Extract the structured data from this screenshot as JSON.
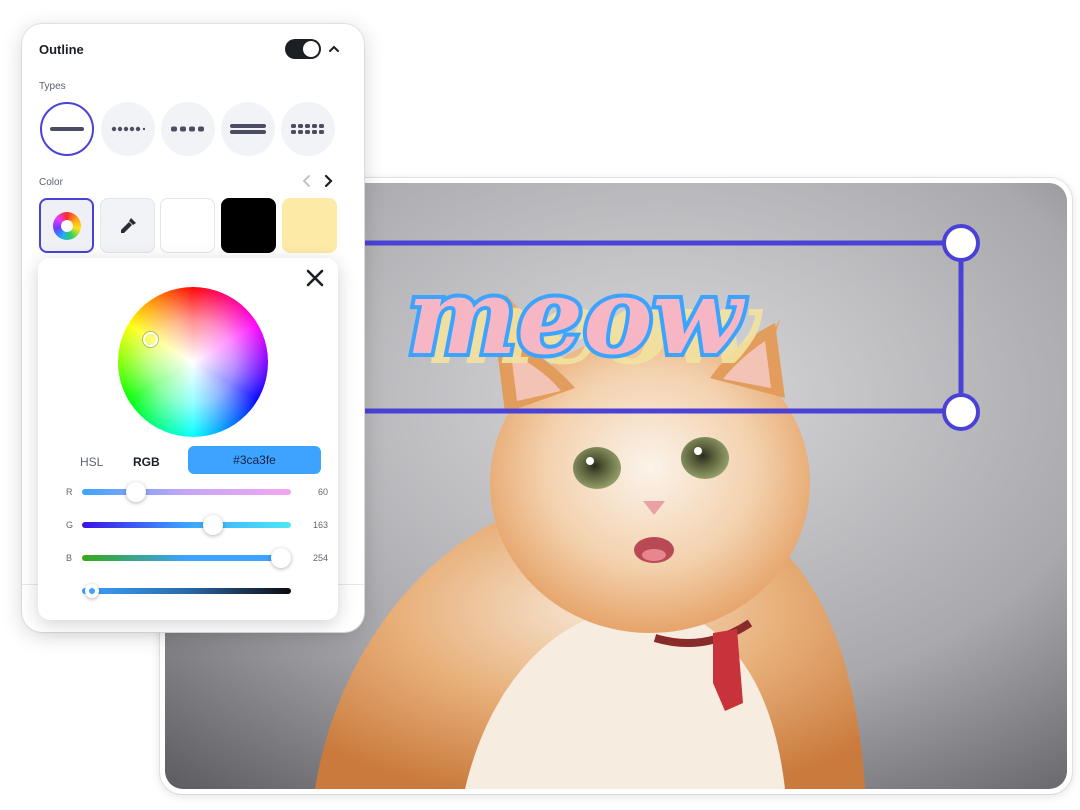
{
  "outline_panel": {
    "title": "Outline",
    "enabled": true,
    "types_label": "Types",
    "types": [
      "solid-line-icon",
      "dotted-line-icon",
      "dashed-line-icon",
      "double-line-icon",
      "double-dotted-line-icon"
    ],
    "selected_type": 0,
    "color_label": "Color",
    "swatches": [
      {
        "kind": "color-wheel-icon"
      },
      {
        "kind": "eyedropper-icon"
      },
      {
        "kind": "color",
        "color": "#ffffff"
      },
      {
        "kind": "color",
        "color": "#000000"
      },
      {
        "kind": "color",
        "color": "#fdeaa7"
      }
    ],
    "selected_swatch": 0
  },
  "color_picker": {
    "modes": [
      "HSL",
      "RGB"
    ],
    "active_mode": "RGB",
    "hex": "#3ca3fe",
    "channels": {
      "r": {
        "label": "R",
        "value": "60"
      },
      "g": {
        "label": "G",
        "value": "163"
      },
      "b": {
        "label": "B",
        "value": "254"
      }
    },
    "alpha_level": 0.05
  },
  "canvas": {
    "text_layer": "meow",
    "text_fill": "#f7b6c4",
    "text_outline": "#3ca3fe",
    "text_shadow": "#f3e3a0",
    "selection_color": "#4a42d6"
  }
}
